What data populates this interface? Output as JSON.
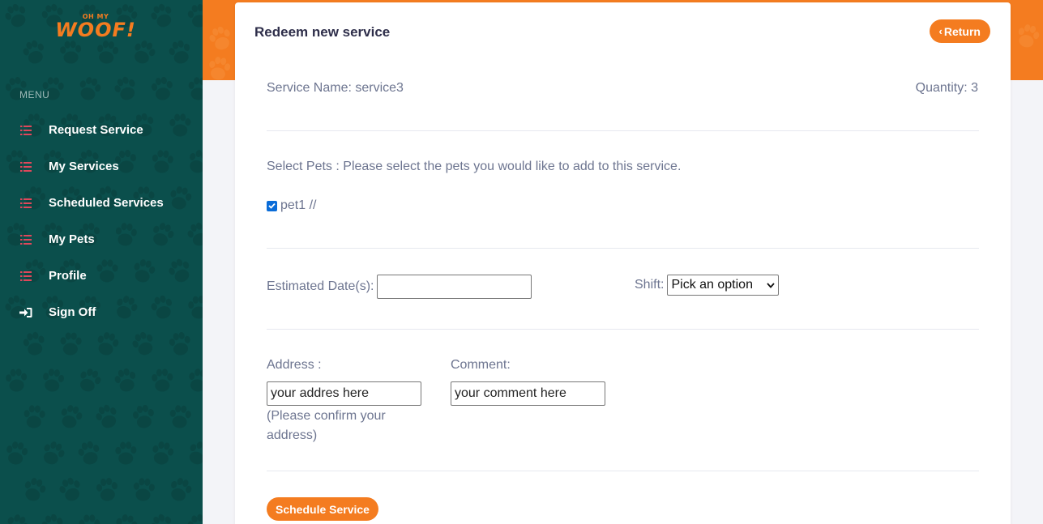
{
  "brand": {
    "small": "OH MY",
    "big": "WOOF!",
    "color": "#f47c20"
  },
  "sidebar": {
    "menu_title": "MENU",
    "items": [
      {
        "label": "Request Service",
        "icon": "list-icon"
      },
      {
        "label": "My Services",
        "icon": "list-icon"
      },
      {
        "label": "Scheduled Services",
        "icon": "list-icon"
      },
      {
        "label": "My Pets",
        "icon": "list-icon"
      },
      {
        "label": "Profile",
        "icon": "list-icon"
      },
      {
        "label": "Sign Off",
        "icon": "sign-in-icon"
      }
    ],
    "bg_color": "#0b4f4c"
  },
  "card": {
    "title": "Redeem new service",
    "return_label": "Return",
    "service_name": "Service Name: service3",
    "quantity": "Quantity: 3",
    "select_pets_text": "Select Pets : Please select the pets you would like to add to this service.",
    "pets": [
      {
        "label": "pet1 //",
        "checked": true
      }
    ],
    "date_label": "Estimated Date(s):",
    "date_value": "",
    "shift_label": "Shift:",
    "shift_selected": "Pick an option",
    "address_label": "Address :",
    "address_value": "your addres here",
    "address_note": "(Please confirm your address)",
    "comment_label": "Comment:",
    "comment_value": "your comment here",
    "schedule_label": "Schedule Service"
  },
  "colors": {
    "accent": "#f47c20",
    "checkbox": "#0a6cd8",
    "icon_red": "#e0475b"
  }
}
